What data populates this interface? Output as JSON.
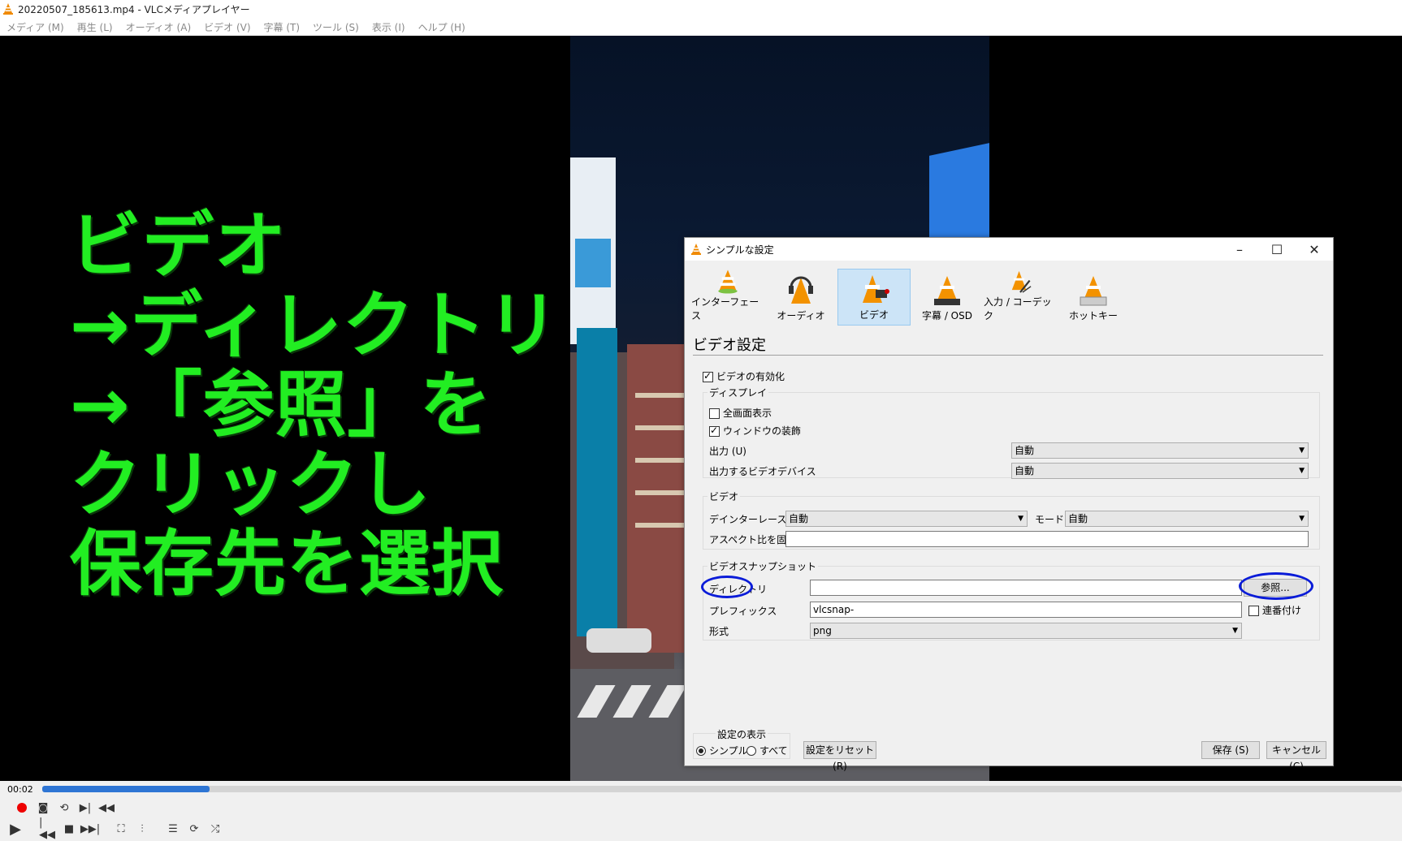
{
  "window": {
    "title": "20220507_185613.mp4 - VLCメディアプレイヤー"
  },
  "menu": [
    "メディア (M)",
    "再生 (L)",
    "オーディオ (A)",
    "ビデオ (V)",
    "字幕 (T)",
    "ツール (S)",
    "表示 (I)",
    "ヘルプ (H)"
  ],
  "overlay": {
    "lines": [
      "ビデオ",
      "→ディレクトリ",
      "→「参照」を",
      "クリックし",
      "保存先を選択"
    ],
    "color": "#22ee22"
  },
  "dialog": {
    "title": "シンプルな設定",
    "categories": [
      "インターフェース",
      "オーディオ",
      "ビデオ",
      "字幕 / OSD",
      "入力 / コーデック",
      "ホットキー"
    ],
    "active_category": "ビデオ",
    "section_title": "ビデオ設定",
    "enable_video": "ビデオの有効化",
    "display_group": {
      "legend": "ディスプレイ",
      "fullscreen": "全画面表示",
      "decorations": "ウィンドウの装飾",
      "output_label": "出力 (U)",
      "output_value": "自動",
      "device_label": "出力するビデオデバイス",
      "device_value": "自動"
    },
    "video_group": {
      "legend": "ビデオ",
      "deinterlace_label": "デインターレース",
      "deinterlace_value": "自動",
      "mode_label": "モード",
      "mode_value": "自動",
      "aspect_label": "アスペクト比を固定",
      "aspect_value": ""
    },
    "snapshot_group": {
      "legend": "ビデオスナップショット",
      "directory_label": "ディレクトリ",
      "directory_value": "",
      "browse_button": "参照...",
      "prefix_label": "プレフィックス",
      "prefix_value": "vlcsnap-",
      "sequential_label": "連番付け",
      "format_label": "形式",
      "format_value": "png"
    },
    "show_settings": {
      "legend": "設定の表示",
      "simple": "シンプル",
      "all": "すべて"
    },
    "reset_button": "設定をリセット (R)",
    "save_button": "保存 (S)",
    "cancel_button": "キャンセル (C)",
    "highlight_color": "#0a1cd8"
  },
  "player": {
    "time": "00:02",
    "progress_fraction": 0.123
  }
}
